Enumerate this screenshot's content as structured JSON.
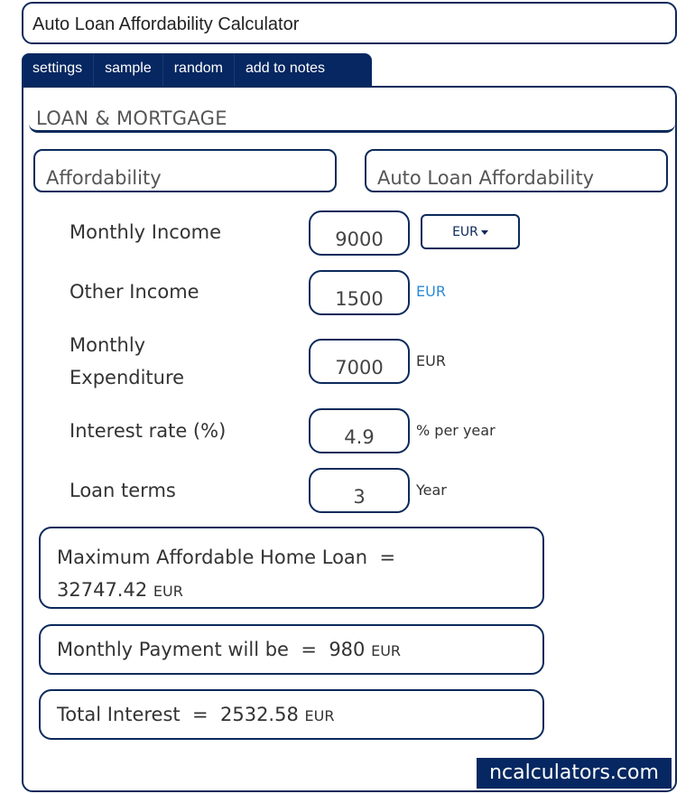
{
  "title": "Auto Loan Affordability Calculator",
  "tabs": [
    {
      "label": "settings"
    },
    {
      "label": "sample"
    },
    {
      "label": "random"
    },
    {
      "label": "add to notes"
    }
  ],
  "section": "LOAN & MORTGAGE",
  "category": {
    "left": "Affordability",
    "right": "Auto Loan Affordability"
  },
  "fields": {
    "monthly_income": {
      "label": "Monthly Income",
      "value": "9000",
      "currency": "EUR"
    },
    "other_income": {
      "label": "Other Income",
      "value": "1500",
      "unit": "EUR"
    },
    "monthly_expenditure": {
      "label_line1": "Monthly",
      "label_line2": "Expenditure",
      "value": "7000",
      "unit": "EUR"
    },
    "interest_rate": {
      "label": "Interest rate (%)",
      "value": "4.9",
      "unit": "% per year"
    },
    "loan_terms": {
      "label": "Loan terms",
      "value": "3",
      "unit": "Year"
    }
  },
  "results": {
    "max_loan": {
      "label": "Maximum Affordable Home Loan",
      "equals": "=",
      "value": "32747.42",
      "unit": "EUR"
    },
    "monthly_payment": {
      "label": "Monthly Payment will be",
      "equals": "=",
      "value": "980",
      "unit": "EUR"
    },
    "total_interest": {
      "label": "Total Interest",
      "equals": "=",
      "value": "2532.58",
      "unit": "EUR"
    }
  },
  "brand": "ncalculators.com"
}
